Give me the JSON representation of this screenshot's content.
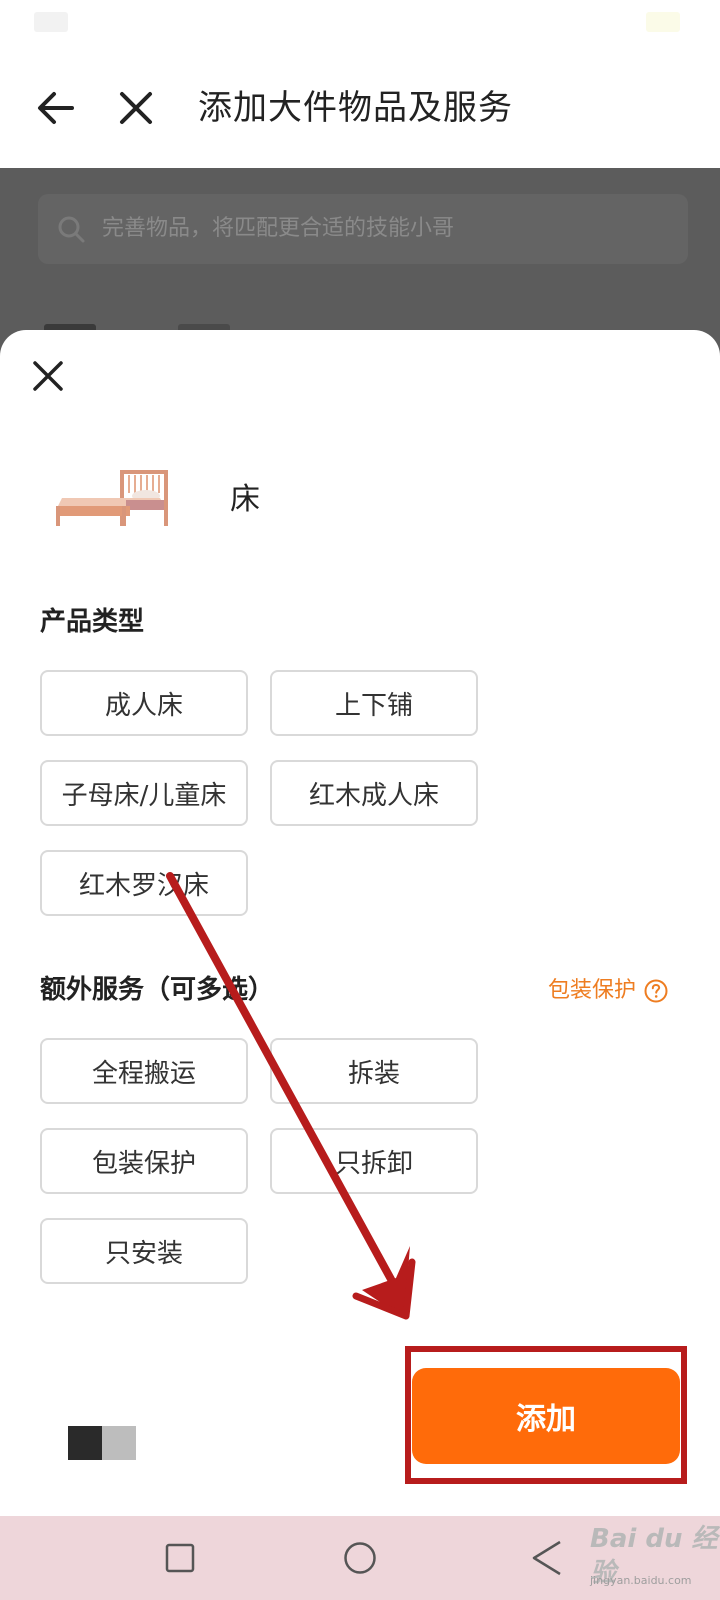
{
  "nav": {
    "title": "添加大件物品及服务"
  },
  "background_page": {
    "search_placeholder": "完善物品，将匹配更合适的技能小哥"
  },
  "sheet": {
    "item": {
      "name": "床",
      "image": "bed-image"
    },
    "product_type": {
      "title": "产品类型",
      "options": [
        "成人床",
        "上下铺",
        "子母床/儿童床",
        "红木成人床",
        "红木罗汉床"
      ]
    },
    "extra_services": {
      "title": "额外服务（可多选）",
      "link_label": "包装保护",
      "link_icon": "help-circle-icon",
      "options": [
        "全程搬运",
        "拆装",
        "包装保护",
        "只拆卸",
        "只安装"
      ]
    },
    "add_button_label": "添加"
  },
  "watermark": {
    "logo": "Bai du 经验",
    "domain": "jingyan.baidu.com"
  },
  "colors": {
    "accent": "#ff6b0a",
    "link": "#ee7d21",
    "annotation": "#b71c1c",
    "overlay": "#5c5c5c",
    "system_nav": "#eed6da"
  }
}
